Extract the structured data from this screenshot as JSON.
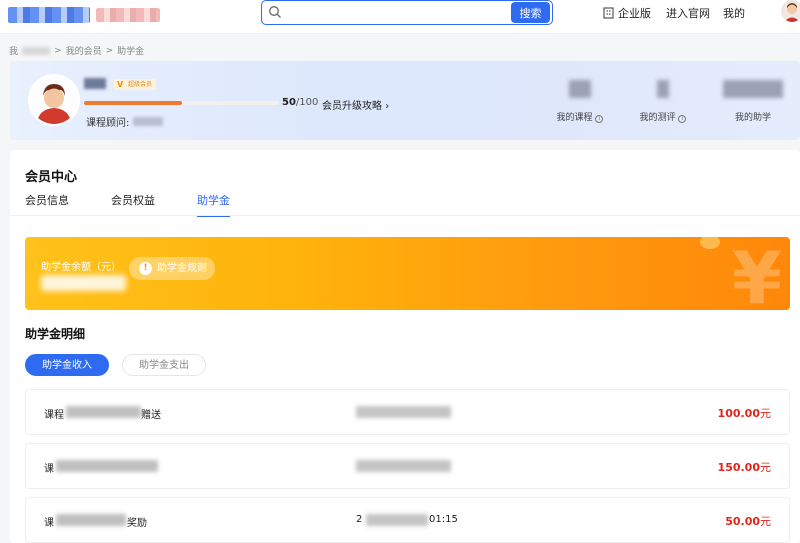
{
  "header": {
    "search": {
      "placeholder": "",
      "button_label": "搜索"
    },
    "nav": {
      "enterprise": "企业版",
      "official_site": "进入官网",
      "my": "我的"
    }
  },
  "breadcrumb": {
    "home": "我",
    "member": "我的会员",
    "current": "助学金",
    "sep": ">"
  },
  "member": {
    "badge": "超级会员",
    "progress": {
      "current": "50",
      "total": "/100",
      "fraction": 0.5
    },
    "upgrade_link": "会员升级攻略",
    "advisor_label": "课程顾问:",
    "stats": {
      "course": "我的课程",
      "evaluation": "我的测评",
      "helper": "我的助学"
    }
  },
  "page": {
    "title": "会员中心",
    "tabs": [
      {
        "label": "会员信息",
        "active": false
      },
      {
        "label": "会员权益",
        "active": false
      },
      {
        "label": "助学金",
        "active": true
      }
    ]
  },
  "fund": {
    "balance_label": "助学金余额（元）",
    "rules_button": "助学金规则",
    "colors": {
      "start": "#ffc21a",
      "end": "#ff870a"
    }
  },
  "detail": {
    "title": "助学金明细",
    "sub_tabs": [
      {
        "label": "助学金收入",
        "active": true
      },
      {
        "label": "助学金支出",
        "active": false
      }
    ],
    "records": [
      {
        "desc_prefix": "课程",
        "desc_suffix": "赠送",
        "date_prefix": "",
        "date_suffix": "",
        "amount": "100.00",
        "unit": "元"
      },
      {
        "desc_prefix": "课",
        "desc_suffix": "",
        "date_prefix": "",
        "date_suffix": "",
        "amount": "150.00",
        "unit": "元"
      },
      {
        "desc_prefix": "课",
        "desc_suffix": "奖励",
        "date_prefix": "2",
        "date_suffix": "01:15",
        "amount": "50.00",
        "unit": "元"
      }
    ]
  },
  "colors": {
    "accent": "#2f6bf0",
    "amount": "#e0251b",
    "progress": "#f07a30"
  }
}
